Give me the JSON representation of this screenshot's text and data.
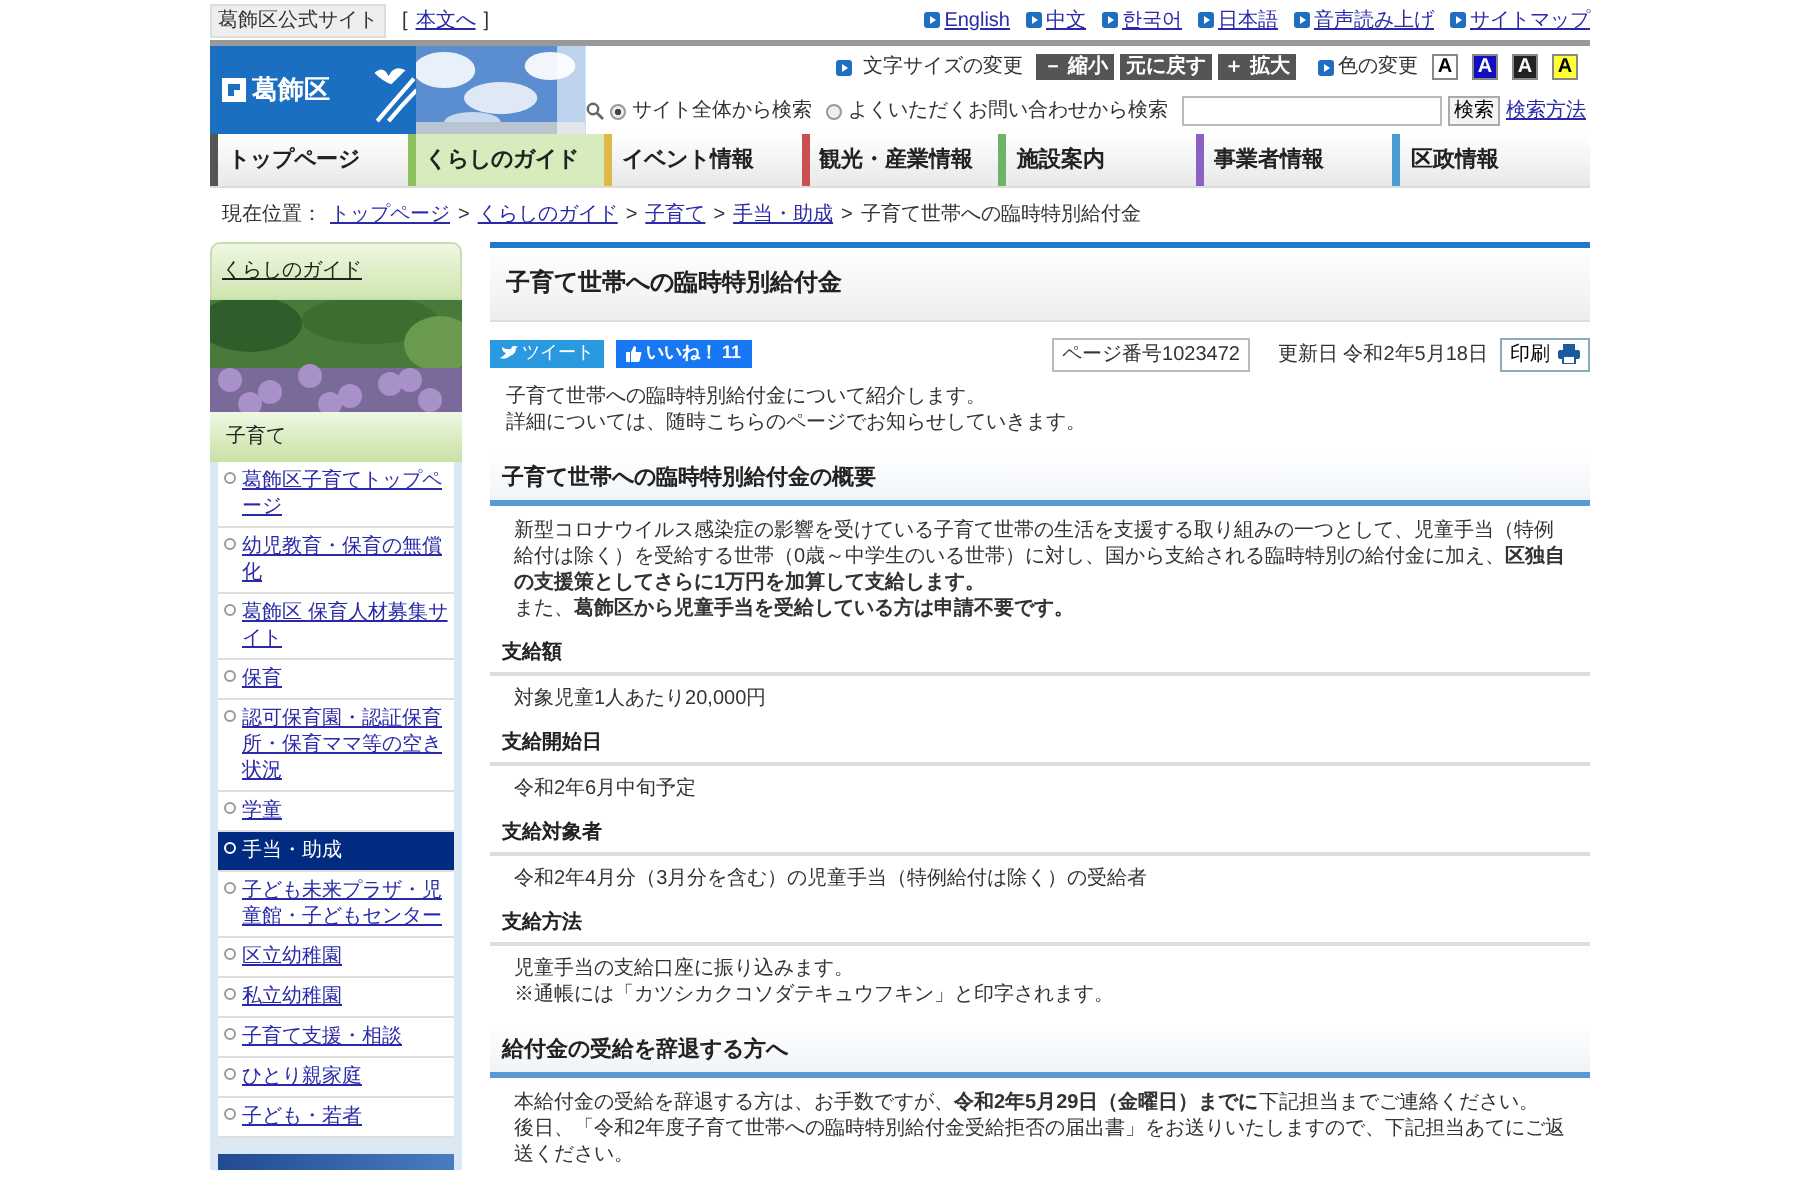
{
  "top_bar": {
    "site_label": "葛飾区公式サイト",
    "skip_open": "[",
    "skip_link": "本文へ",
    "skip_close": "]",
    "links": [
      "English",
      "中文",
      "한국어",
      "日本語",
      "音声読み上げ",
      "サイトマップ"
    ]
  },
  "header": {
    "logo_text": "葛飾区",
    "text_size": {
      "label": "文字サイズの変更",
      "buttons": [
        "－ 縮小",
        "元に戻す",
        "＋ 拡大"
      ]
    },
    "color_change": {
      "label": "色の変更",
      "options": [
        {
          "label": "A",
          "color": "#ffffff"
        },
        {
          "label": "A",
          "color": "#1010c0"
        },
        {
          "label": "A",
          "color": "#222222"
        },
        {
          "label": "A",
          "color": "#ffff33"
        }
      ]
    },
    "search": {
      "scopes": [
        {
          "label": "サイト全体から検索",
          "selected": true
        },
        {
          "label": "よくいただくお問い合わせから検索",
          "selected": false
        }
      ],
      "button": "検索",
      "help_link": "検索方法"
    }
  },
  "nav": [
    {
      "label": "トップページ",
      "selected": false,
      "color": "#555555"
    },
    {
      "label": "くらしのガイド",
      "selected": true,
      "color": "#8cc05a"
    },
    {
      "label": "イベント情報",
      "selected": false,
      "color": "#e0b84a"
    },
    {
      "label": "観光・産業情報",
      "selected": false,
      "color": "#c85050"
    },
    {
      "label": "施設案内",
      "selected": false,
      "color": "#6cb46c"
    },
    {
      "label": "事業者情報",
      "selected": false,
      "color": "#8a62c0"
    },
    {
      "label": "区政情報",
      "selected": false,
      "color": "#4a9ad4"
    }
  ],
  "breadcrumb": [
    {
      "kind": "label",
      "text": "現在位置："
    },
    {
      "kind": "link",
      "text": "トップページ"
    },
    {
      "kind": "separator",
      "text": ">"
    },
    {
      "kind": "link",
      "text": "くらしのガイド"
    },
    {
      "kind": "separator",
      "text": ">"
    },
    {
      "kind": "link",
      "text": "子育て"
    },
    {
      "kind": "separator",
      "text": ">"
    },
    {
      "kind": "link",
      "text": "手当・助成"
    },
    {
      "kind": "separator",
      "text": ">"
    },
    {
      "kind": "current",
      "text": "子育て世帯への臨時特別給付金"
    }
  ],
  "sidebar": {
    "title": "くらしのガイド",
    "section": "子育て",
    "items": [
      {
        "label": "葛飾区子育てトップページ",
        "selected": false
      },
      {
        "label": "幼児教育・保育の無償化",
        "selected": false
      },
      {
        "label": "葛飾区 保育人材募集サイト",
        "selected": false
      },
      {
        "label": "保育",
        "selected": false
      },
      {
        "label": "認可保育園・認証保育所・保育ママ等の空き状況",
        "selected": false
      },
      {
        "label": "学童",
        "selected": false
      },
      {
        "label": "手当・助成",
        "selected": true
      },
      {
        "label": "子ども未来プラザ・児童館・子どもセンター",
        "selected": false
      },
      {
        "label": "区立幼稚園",
        "selected": false
      },
      {
        "label": "私立幼稚園",
        "selected": false
      },
      {
        "label": "子育て支援・相談",
        "selected": false
      },
      {
        "label": "ひとり親家庭",
        "selected": false
      },
      {
        "label": "子ども・若者",
        "selected": false
      }
    ]
  },
  "article": {
    "title": "子育て世帯への臨時特別給付金",
    "tweet": "ツイート",
    "like": "いいね！",
    "like_count": "11",
    "page_number": "ページ番号1023472",
    "updated": "更新日 令和2年5月18日",
    "print": "印刷",
    "intro": [
      "子育て世帯への臨時特別給付金について紹介します。",
      "詳細については、随時こちらのページでお知らせしていきます。"
    ],
    "sections": [
      {
        "heading": "子育て世帯への臨時特別給付金の概要",
        "body": [
          "新型コロナウイルス感染症の影響を受けている子育て世帯の生活を支援する取り組みの一つとして、児童手当（特例給付は除く）を受給する世帯（0歳～中学生のいる世帯）に対し、国から支給される臨時特別の給付金に加え、**区独自の支援策としてさらに1万円を加算して支給します。**",
          "また、**葛飾区から児童手当を受給している方は申請不要です。**"
        ],
        "items": [
          {
            "heading": "支給額",
            "body": [
              "対象児童1人あたり20,000円"
            ]
          },
          {
            "heading": "支給開始日",
            "body": [
              "令和2年6月中旬予定"
            ]
          },
          {
            "heading": "支給対象者",
            "body": [
              "令和2年4月分（3月分を含む）の児童手当（特例給付は除く）の受給者"
            ]
          },
          {
            "heading": "支給方法",
            "body": [
              "児童手当の支給口座に振り込みます。",
              "※通帳には「カツシカクコソダテキュウフキン」と印字されます。"
            ]
          }
        ]
      },
      {
        "heading": "給付金の受給を辞退する方へ",
        "body": [
          "本給付金の受給を辞退する方は、お手数ですが、**令和2年5月29日（金曜日）までに**下記担当までご連絡ください。",
          "後日、「令和2年度子育て世帯への臨時特別給付金受給拒否の届出書」をお送りいたしますので、下記担当あてにご返送ください。"
        ]
      }
    ]
  }
}
